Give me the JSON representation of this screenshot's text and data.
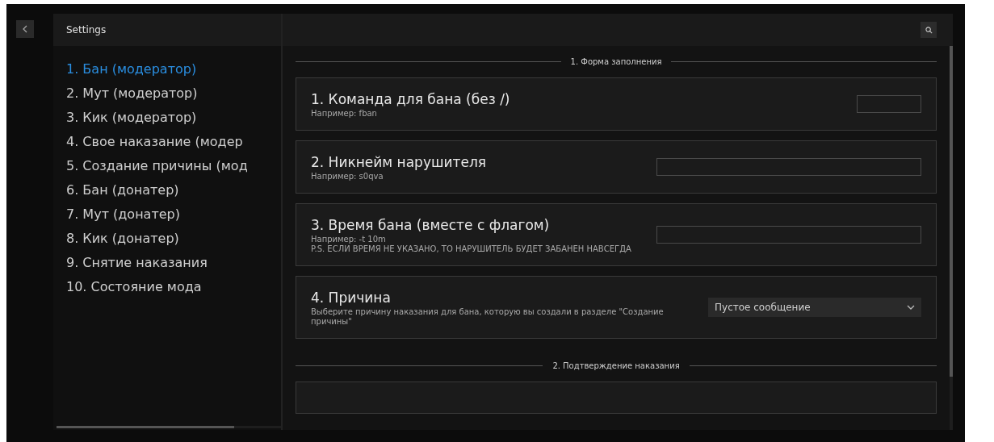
{
  "window": {
    "title": "Settings"
  },
  "sidebar": {
    "items": [
      {
        "label": "1. Бан (модератор)",
        "selected": true
      },
      {
        "label": "2. Мут (модератор)",
        "selected": false
      },
      {
        "label": "3. Кик (модератор)",
        "selected": false
      },
      {
        "label": "4. Свое наказание (модер",
        "selected": false
      },
      {
        "label": "5. Создание причины (мод",
        "selected": false
      },
      {
        "label": "6. Бан (донатер)",
        "selected": false
      },
      {
        "label": "7. Мут (донатер)",
        "selected": false
      },
      {
        "label": "8. Кик (донатер)",
        "selected": false
      },
      {
        "label": "9. Снятие наказания",
        "selected": false
      },
      {
        "label": "10. Состояние мода",
        "selected": false
      }
    ]
  },
  "sections": [
    {
      "title": "1. Форма заполнения",
      "cards": [
        {
          "kind": "short",
          "title": "1. Команда для бана (без /)",
          "hints": [
            "Например: fban"
          ]
        },
        {
          "kind": "input",
          "title": "2. Никнейм нарушителя",
          "hints": [
            "Например: s0qva"
          ]
        },
        {
          "kind": "input",
          "title": "3. Время бана (вместе с флагом)",
          "hints": [
            "Например: -t 10m",
            "P.S. ЕСЛИ ВРЕМЯ НЕ УКАЗАНО, ТО НАРУШИТЕЛЬ БУДЕТ ЗАБАНЕН НАВСЕГДА"
          ]
        },
        {
          "kind": "select",
          "title": "4. Причина",
          "hints": [
            "Выберите причину наказания для бана, которую вы создали в разделе \"Создание причины\""
          ],
          "value": "Пустое сообщение"
        }
      ]
    },
    {
      "title": "2. Подтверждение наказания",
      "cards": [
        {
          "kind": "empty"
        }
      ]
    }
  ]
}
